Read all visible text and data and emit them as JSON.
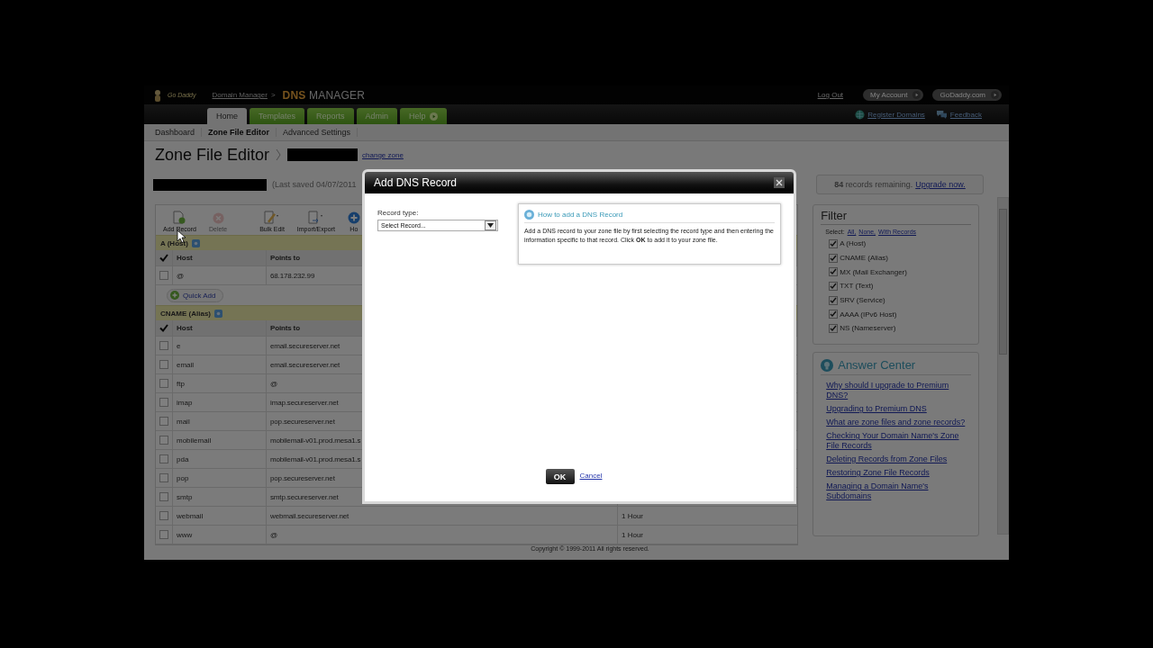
{
  "header": {
    "logo_text": "Go Daddy",
    "breadcrumb_link": "Domain Manager",
    "breadcrumb_separator": ">",
    "product_mark": "DNS",
    "product_name": "MANAGER",
    "log_out": "Log Out",
    "pills": [
      "My Account",
      "GoDaddy.com"
    ]
  },
  "tabs": [
    {
      "label": "Home",
      "selected": true,
      "kind": "plain"
    },
    {
      "label": "Templates",
      "selected": false,
      "kind": "plain"
    },
    {
      "label": "Reports",
      "selected": false,
      "kind": "plain"
    },
    {
      "label": "Admin",
      "selected": false,
      "kind": "plain"
    },
    {
      "label": "Help",
      "selected": false,
      "kind": "arrow"
    }
  ],
  "utility_links": [
    {
      "label": "Register Domains",
      "kind": "globe"
    },
    {
      "label": "Feedback",
      "kind": "chat"
    }
  ],
  "subnav": [
    {
      "label": "Dashboard",
      "selected": false
    },
    {
      "label": "Zone File Editor",
      "selected": true
    },
    {
      "label": "Advanced Settings",
      "selected": false
    }
  ],
  "page_title": "Zone File Editor",
  "change_zone": "change zone",
  "last_saved": "(Last saved 04/07/2011",
  "records_remaining": {
    "count": "84",
    "text": "records remaining.",
    "link": "Upgrade now."
  },
  "toolbar": [
    {
      "label": "Add Record",
      "kind": "add",
      "disabled": false
    },
    {
      "label": "Delete",
      "kind": "delete",
      "disabled": true
    },
    {
      "label": "Bulk Edit",
      "kind": "edit",
      "disabled": false
    },
    {
      "label": "Import/Export",
      "kind": "import",
      "disabled": false
    },
    {
      "label": "Ho",
      "kind": "plus",
      "disabled": false
    }
  ],
  "sections": [
    {
      "title": "A (Host)",
      "columns": [
        "Host",
        "Points to"
      ],
      "quick_add": "Quick Add",
      "rows": [
        {
          "checked": false,
          "host": "@",
          "points_to": "68.178.232.99"
        }
      ]
    },
    {
      "title": "CNAME (Alias)",
      "columns": [
        "Host",
        "Points to"
      ],
      "rows": [
        {
          "checked": false,
          "host": "e",
          "points_to": "email.secureserver.net"
        },
        {
          "checked": false,
          "host": "email",
          "points_to": "email.secureserver.net"
        },
        {
          "checked": false,
          "host": "ftp",
          "points_to": "@"
        },
        {
          "checked": false,
          "host": "imap",
          "points_to": "imap.secureserver.net"
        },
        {
          "checked": false,
          "host": "mail",
          "points_to": "pop.secureserver.net"
        },
        {
          "checked": false,
          "host": "mobilemail",
          "points_to": "mobilemail-v01.prod.mesa1.s"
        },
        {
          "checked": false,
          "host": "pda",
          "points_to": "mobilemail-v01.prod.mesa1.s"
        },
        {
          "checked": false,
          "host": "pop",
          "points_to": "pop.secureserver.net"
        },
        {
          "checked": false,
          "host": "smtp",
          "points_to": "smtp.secureserver.net"
        },
        {
          "checked": false,
          "host": "webmail",
          "points_to": "webmail.secureserver.net",
          "column_3": "1 Hour"
        },
        {
          "checked": false,
          "host": "www",
          "points_to": "@",
          "column_3": "1 Hour"
        }
      ]
    }
  ],
  "filter": {
    "title": "Filter",
    "select_label": "Select:",
    "select_links": [
      "All,",
      "None,",
      "With Records"
    ],
    "items": [
      {
        "label": "A (Host)",
        "checked": true
      },
      {
        "label": "CNAME (Alias)",
        "checked": true
      },
      {
        "label": "MX (Mail Exchanger)",
        "checked": true
      },
      {
        "label": "TXT (Text)",
        "checked": true
      },
      {
        "label": "SRV (Service)",
        "checked": true
      },
      {
        "label": "AAAA (IPv6 Host)",
        "checked": true
      },
      {
        "label": "NS (Nameserver)",
        "checked": true
      }
    ]
  },
  "answer_center": {
    "title": "Answer Center",
    "links": [
      "Why should I upgrade to Premium DNS?",
      "Upgrading to Premium DNS",
      "What are zone files and zone records?",
      "Checking Your Domain Name's Zone File Records",
      "Deleting Records from Zone Files",
      "Restoring Zone File Records",
      "Managing a Domain Name's Subdomains"
    ]
  },
  "footer": "Copyright © 1999-2011 All rights reserved.",
  "modal": {
    "title": "Add DNS Record",
    "field_label": "Record type:",
    "select_value": "Select Record...",
    "help_title": "How to add a DNS Record",
    "help_text": "Add a DNS record to your zone file by first selecting the record type and then entering the information specific to that record. Click **OK** to add it to your zone file.",
    "ok": "OK",
    "cancel": "Cancel"
  }
}
